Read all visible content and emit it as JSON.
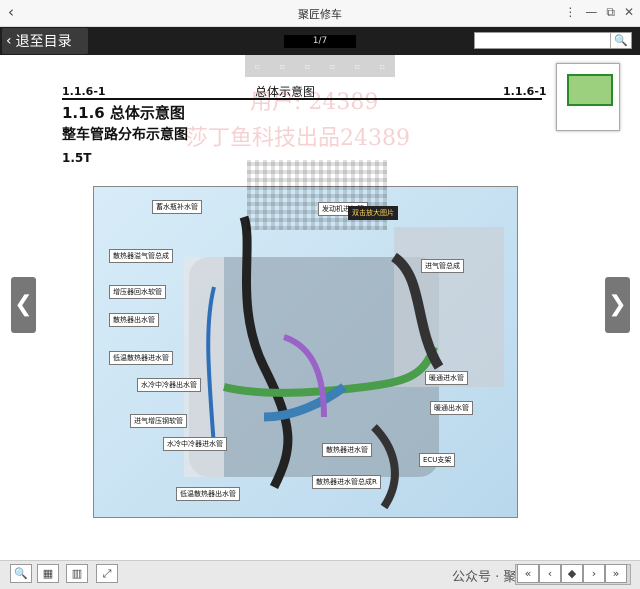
{
  "window": {
    "title": "聚匠修车",
    "back_glyph": "‹",
    "controls": [
      "⋮",
      "—",
      "⧉",
      "✕"
    ]
  },
  "toolbar": {
    "back_to_toc": "退至目录",
    "page_indicator": "1/7",
    "search_icon": "🔍"
  },
  "document": {
    "header_left": "1.1.6-1",
    "header_center": "总体示意图",
    "header_right": "1.1.6-1",
    "section_title": "1.1.6  总体示意图",
    "subtitle": "整车管路分布示意图",
    "engine": "1.5T",
    "watermark_1": "用户: 24389",
    "watermark_2": "莎丁鱼科技出品24389"
  },
  "figure": {
    "tooltip": "双击放大图片",
    "labels": [
      "蓄水瓶补水管",
      "散热器溢气管总成",
      "增压器回水软管",
      "散热器出水管",
      "低温散热器进水管",
      "水冷中冷器出水管",
      "进气增压钢软管",
      "水冷中冷器进水管",
      "低温散热器出水管",
      "发动机进气管",
      "进气管总成",
      "暖通进水管",
      "暖通出水管",
      "ECU支架",
      "散热器进水管",
      "散热器进水管总成R"
    ]
  },
  "nav": {
    "prev": "❮",
    "next": "❯"
  },
  "bottom": {
    "zoom": "🔍",
    "grid": "▦",
    "book": "▥",
    "expand": "⤢",
    "wechat": "公众号 · 聚匠修车",
    "pager": [
      "«",
      "‹",
      "◆",
      "›",
      "»"
    ]
  }
}
